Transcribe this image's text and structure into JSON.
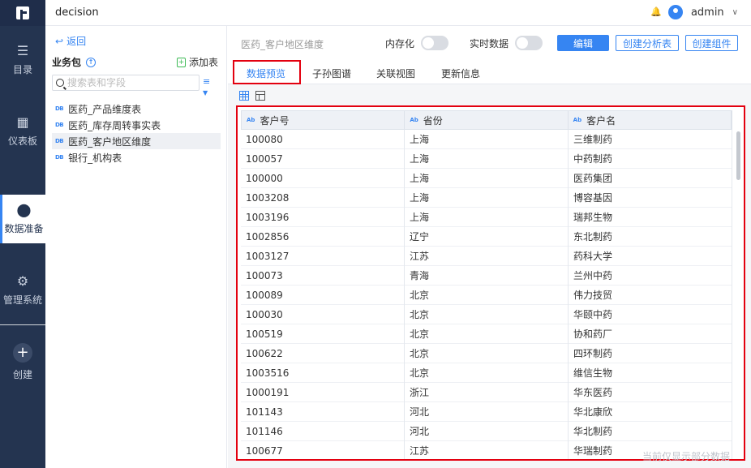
{
  "app": {
    "title": "decision",
    "user": "admin"
  },
  "sidebar": {
    "items": [
      {
        "label": "目录",
        "icon": "list-icon"
      },
      {
        "label": "仪表板",
        "icon": "dashboard-icon"
      },
      {
        "label": "数据准备",
        "icon": "database-icon"
      },
      {
        "label": "管理系统",
        "icon": "gear-icon"
      },
      {
        "label": "创建",
        "icon": "plus-icon"
      }
    ]
  },
  "left_panel": {
    "back_label": "返回",
    "package_title": "业务包",
    "add_table_label": "添加表",
    "search_placeholder": "搜索表和字段",
    "tables": [
      {
        "name": "医药_产品维度表",
        "badge": "DB"
      },
      {
        "name": "医药_库存周转事实表",
        "badge": "DB"
      },
      {
        "name": "医药_客户地区维度",
        "badge": "DB"
      },
      {
        "name": "银行_机构表",
        "badge": "DB"
      }
    ]
  },
  "header": {
    "table_name": "医药_客户地区维度",
    "toggle_memory": "内存化",
    "toggle_realtime": "实时数据",
    "edit_button": "编辑",
    "create_analysis_button": "创建分析表",
    "create_component_button": "创建组件"
  },
  "tabs": [
    {
      "label": "数据预览",
      "active": true
    },
    {
      "label": "子孙图谱"
    },
    {
      "label": "关联视图"
    },
    {
      "label": "更新信息"
    }
  ],
  "grid": {
    "type_badge": "Ab",
    "columns": [
      "客户号",
      "省份",
      "客户名"
    ],
    "rows": [
      [
        "100080",
        "上海",
        "三维制药"
      ],
      [
        "100057",
        "上海",
        "中药制药"
      ],
      [
        "100000",
        "上海",
        "医药集团"
      ],
      [
        "1003208",
        "上海",
        "博容基因"
      ],
      [
        "1003196",
        "上海",
        "瑞邦生物"
      ],
      [
        "1002856",
        "辽宁",
        "东北制药"
      ],
      [
        "1003127",
        "江苏",
        "药科大学"
      ],
      [
        "100073",
        "青海",
        "兰州中药"
      ],
      [
        "100089",
        "北京",
        "伟力技贸"
      ],
      [
        "100030",
        "北京",
        "华颐中药"
      ],
      [
        "100519",
        "北京",
        "协和药厂"
      ],
      [
        "100622",
        "北京",
        "四环制药"
      ],
      [
        "1003516",
        "北京",
        "维信生物"
      ],
      [
        "1000191",
        "浙江",
        "华东医药"
      ],
      [
        "101143",
        "河北",
        "华北康欣"
      ],
      [
        "101146",
        "河北",
        "华北制药"
      ],
      [
        "100677",
        "江苏",
        "华瑞制药"
      ]
    ],
    "footnote": "当前仅显示部分数据"
  }
}
